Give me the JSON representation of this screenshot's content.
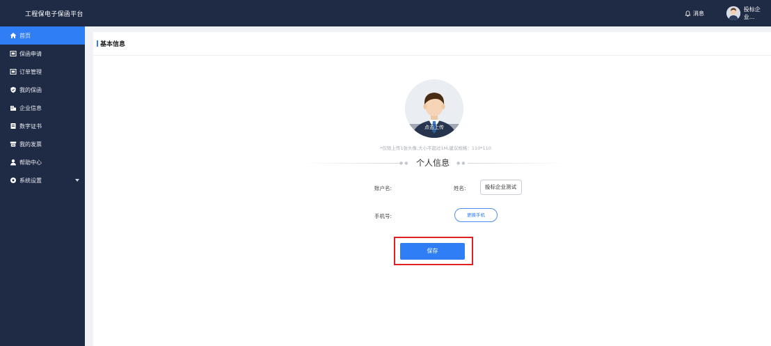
{
  "topbar": {
    "app_title": "工程保电子保函平台",
    "messages_label": "消息",
    "user_name": "投标企业..."
  },
  "sidebar": {
    "items": [
      {
        "label": "首页",
        "icon": "home-icon",
        "active": true
      },
      {
        "label": "保函申请",
        "icon": "application-icon",
        "active": false
      },
      {
        "label": "订单管理",
        "icon": "order-icon",
        "active": false
      },
      {
        "label": "我的保函",
        "icon": "shield-icon",
        "active": false
      },
      {
        "label": "企业信息",
        "icon": "building-icon",
        "active": false
      },
      {
        "label": "数字证书",
        "icon": "certificate-icon",
        "active": false
      },
      {
        "label": "我的发票",
        "icon": "invoice-icon",
        "active": false
      },
      {
        "label": "帮助中心",
        "icon": "help-icon",
        "active": false
      },
      {
        "label": "系统设置",
        "icon": "settings-icon",
        "active": false,
        "has_submenu": true
      }
    ]
  },
  "main": {
    "panel_title": "基本信息",
    "avatar_upload_label": "点击上传",
    "upload_hint": "*仅限上传1张头像,大小不超过1M,建议规格：110*110",
    "section_title": "个人信息",
    "form": {
      "account_label": "账户名:",
      "name_label": "姓名:",
      "name_value": "投标企业测试",
      "phone_label": "手机号:",
      "change_phone_label": "更换手机"
    },
    "save_label": "保存"
  },
  "colors": {
    "sidebar_bg": "#1f2a44",
    "accent": "#2f7ef5",
    "highlight_border": "#e02020"
  }
}
